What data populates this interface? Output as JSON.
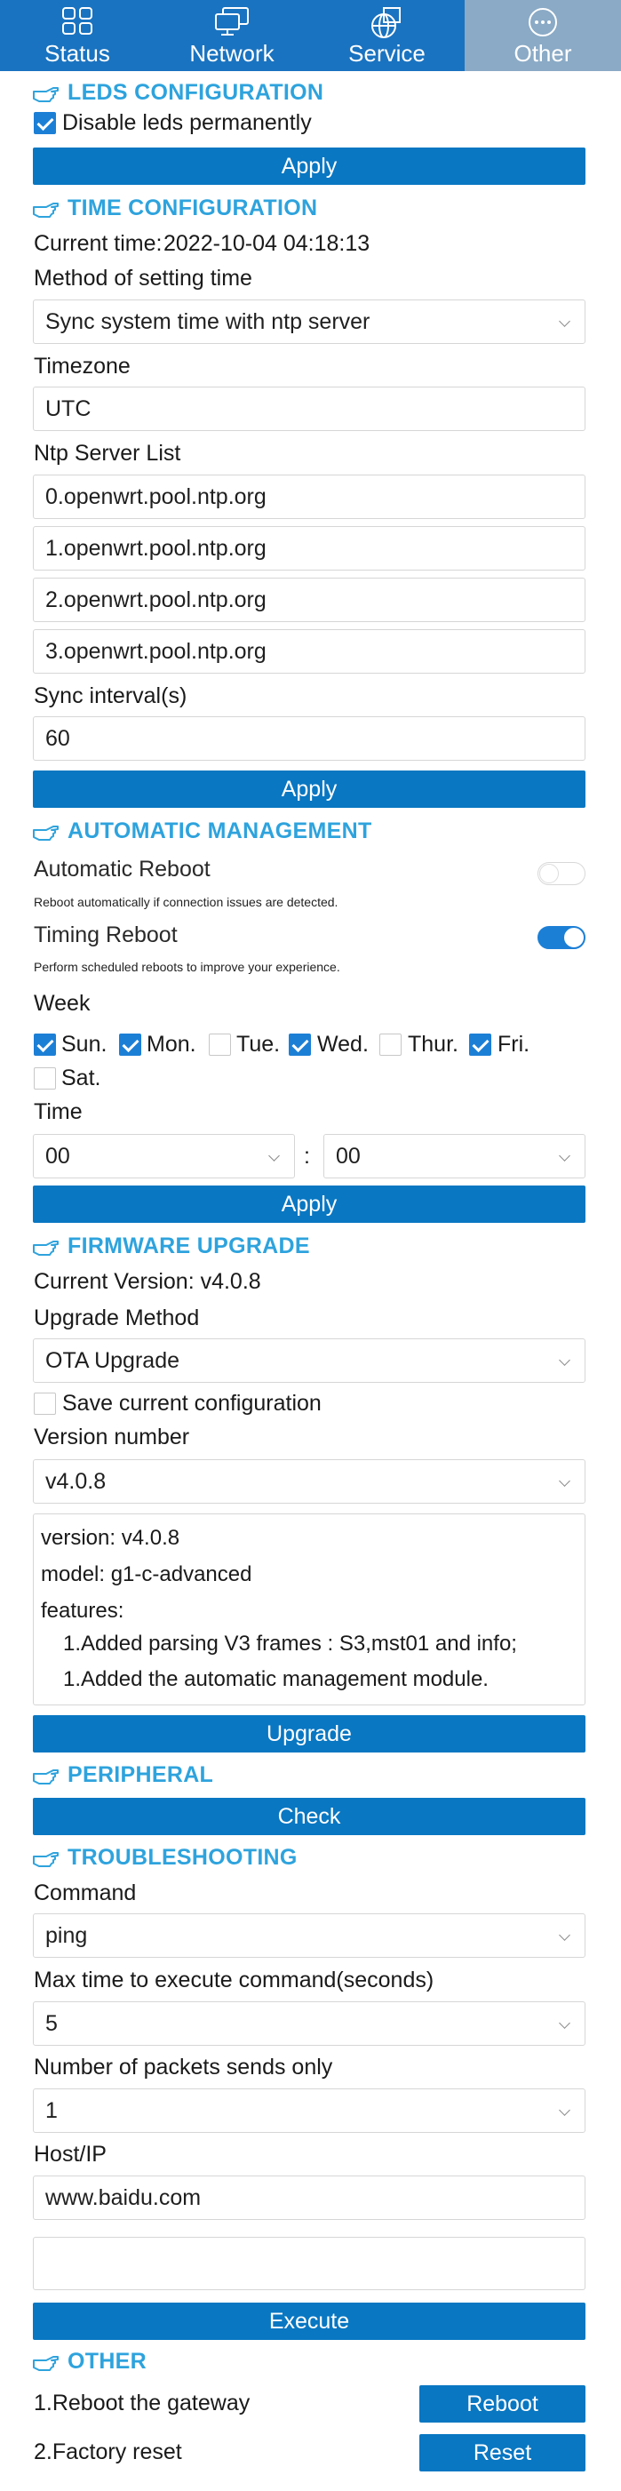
{
  "nav": {
    "items": [
      {
        "label": "Status",
        "icon": "status-grid-icon",
        "active": false
      },
      {
        "label": "Network",
        "icon": "network-monitors-icon",
        "active": false
      },
      {
        "label": "Service",
        "icon": "service-globe-icon",
        "active": false
      },
      {
        "label": "Other",
        "icon": "other-dots-icon",
        "active": true
      }
    ],
    "colors": {
      "bar": "#1a73c0",
      "active": "#8aaac6"
    }
  },
  "colors": {
    "section_title": "#2ea3dd",
    "button": "#0977c2",
    "check": "#1c7fd6"
  },
  "leds": {
    "title": "LEDS CONFIGURATION",
    "disable_label": "Disable leds permanently",
    "disable_checked": true,
    "apply": "Apply"
  },
  "time": {
    "title": "TIME CONFIGURATION",
    "current_label": "Current time:",
    "current_value": "2022-10-04 04:18:13",
    "method_label": "Method of setting time",
    "method_value": "Sync system time with ntp server",
    "timezone_label": "Timezone",
    "timezone_value": "UTC",
    "ntp_label": "Ntp Server List",
    "ntp_servers": [
      "0.openwrt.pool.ntp.org",
      "1.openwrt.pool.ntp.org",
      "2.openwrt.pool.ntp.org",
      "3.openwrt.pool.ntp.org"
    ],
    "sync_label": "Sync interval(s)",
    "sync_value": "60",
    "apply": "Apply"
  },
  "auto": {
    "title": "AUTOMATIC MANAGEMENT",
    "reboot_label": "Automatic Reboot",
    "reboot_desc": "Reboot automatically if connection issues are detected.",
    "reboot_on": false,
    "timing_label": "Timing Reboot",
    "timing_desc": "Perform scheduled reboots to improve your experience.",
    "timing_on": true,
    "week_label": "Week",
    "days": [
      {
        "label": "Sun.",
        "checked": true
      },
      {
        "label": "Mon.",
        "checked": true
      },
      {
        "label": "Tue.",
        "checked": false
      },
      {
        "label": "Wed.",
        "checked": true
      },
      {
        "label": "Thur.",
        "checked": false
      },
      {
        "label": "Fri.",
        "checked": true
      },
      {
        "label": "Sat.",
        "checked": false
      }
    ],
    "time_label": "Time",
    "hour": "00",
    "separator": ":",
    "minute": "00",
    "apply": "Apply"
  },
  "firmware": {
    "title": "FIRMWARE UPGRADE",
    "current_version": "Current Version: v4.0.8",
    "method_label": "Upgrade Method",
    "method_value": "OTA Upgrade",
    "save_label": "Save current configuration",
    "save_checked": false,
    "version_label": "Version number",
    "version_value": "v4.0.8",
    "notes": {
      "version": "version: v4.0.8",
      "model": "model: g1-c-advanced",
      "features": "features:",
      "items": [
        "1.Added parsing V3 frames : S3,mst01 and info;",
        "1.Added the automatic management module."
      ]
    },
    "upgrade": "Upgrade"
  },
  "peripheral": {
    "title": "PERIPHERAL",
    "check": "Check"
  },
  "troubleshooting": {
    "title": "TROUBLESHOOTING",
    "command_label": "Command",
    "command_value": "ping",
    "max_time_label": "Max time to execute command(seconds)",
    "max_time_value": "5",
    "packets_label": "Number of packets sends only",
    "packets_value": "1",
    "host_label": "Host/IP",
    "host_value": "www.baidu.com",
    "output_value": "",
    "execute": "Execute"
  },
  "other": {
    "title": "OTHER",
    "reboot_label": "1.Reboot the gateway",
    "reboot_button": "Reboot",
    "reset_label": "2.Factory reset",
    "reset_button": "Reset"
  }
}
